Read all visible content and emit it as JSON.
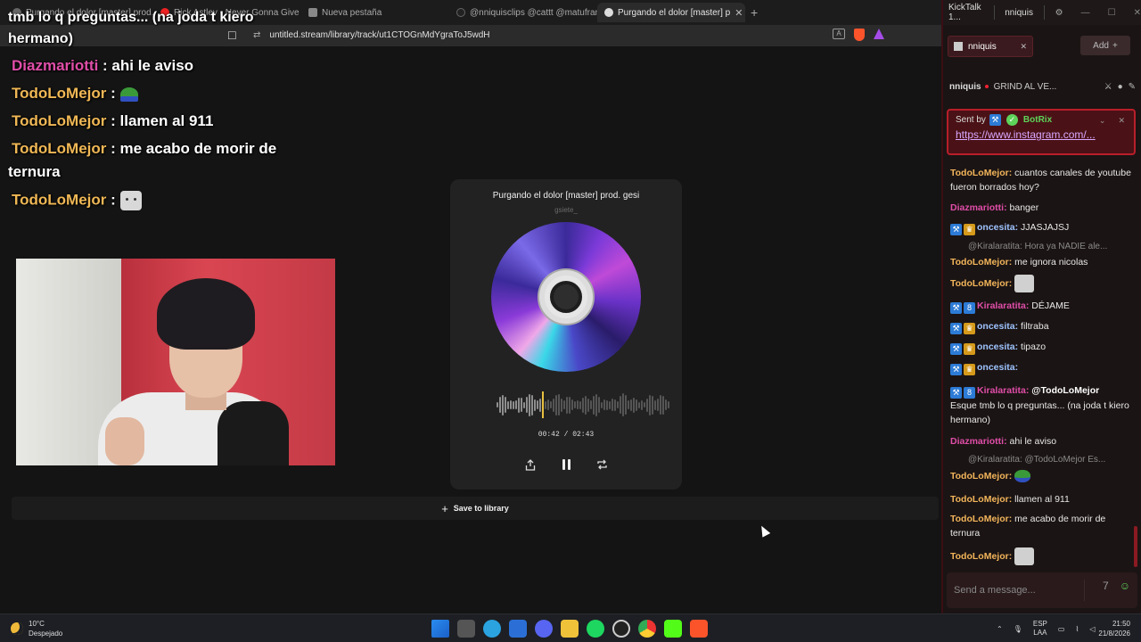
{
  "browser": {
    "tabs": [
      {
        "label": "Purgando el dolor [master] prod..."
      },
      {
        "label": "Rick Astley - Never Gonna Give You U"
      },
      {
        "label": "Nueva pestaña"
      },
      {
        "label": "@nniquisclips @cattt  @matufran"
      },
      {
        "label": "Purgando el dolor [master] p",
        "active": true
      }
    ],
    "url": "untitled.stream/library/track/ut1CTOGnMdYgraToJ5wdH"
  },
  "overlay": {
    "top_line_1": "tmb lo q preguntas... (na joda t kiero",
    "top_line_2": "hermano)",
    "msgs": [
      {
        "user": "Diazmariotti",
        "sep": " : ",
        "text": "ahi le aviso"
      },
      {
        "user": "TodoLoMejor",
        "sep": " : ",
        "text": ""
      },
      {
        "user": "TodoLoMejor",
        "sep": " : ",
        "text": "llamen al 911"
      },
      {
        "user": "TodoLoMejor",
        "sep": " : ",
        "text": "me acabo de morir de"
      },
      {
        "user": "TodoLoMejor",
        "sep": " : ",
        "text": ""
      }
    ],
    "wrap_text": "ternura"
  },
  "player": {
    "title": "Purgando el dolor [master] prod. gesi",
    "artist": "gsiete_",
    "time": "00:42 / 02:43",
    "progress": 0.26,
    "save_label": "Save to library"
  },
  "kicktalk": {
    "app_title": "KickTalk 1...",
    "user": "nniquis",
    "tab_label": "nniquis",
    "add_label": "Add",
    "channel": "nniquis",
    "stream_title": "GRIND AL VE...",
    "pinned": {
      "sent_by": "Sent by",
      "bot": "BotRix",
      "link": "https://www.instagram.com/..."
    },
    "chat": [
      {
        "user": "TodoLoMejor:",
        "text": "cuantos canales de youtube fueron borrados hoy?"
      },
      {
        "user": "Diazmariotti:",
        "text": "banger"
      },
      {
        "user": "oncesita:",
        "text": "JJASJAJSJ"
      },
      {
        "reply": "@Kiralaratita: Hora ya NADIE ale..."
      },
      {
        "user": "TodoLoMejor:",
        "text": "me ignora nicolas"
      },
      {
        "user": "TodoLoMejor:",
        "text": ""
      },
      {
        "user": "Kiralaratita:",
        "text": "DÉJAME"
      },
      {
        "user": "oncesita:",
        "text": "filtraba"
      },
      {
        "user": "oncesita:",
        "text": "tipazo"
      },
      {
        "user": "oncesita:",
        "text": ""
      },
      {
        "user": "Kiralaratita:",
        "text": "@TodoLoMejor"
      },
      {
        "text": "Esque tmb lo q preguntas... (na joda t kiero hermano)"
      },
      {
        "user": "Diazmariotti:",
        "text": "ahi le aviso"
      },
      {
        "reply": "@Kiralaratita: @TodoLoMejor Es..."
      },
      {
        "user": "TodoLoMejor:",
        "text": ""
      },
      {
        "user": "TodoLoMejor:",
        "text": "llamen al 911"
      },
      {
        "user": "TodoLoMejor:",
        "text": "me acabo de morir de ternura"
      },
      {
        "user": "TodoLoMejor:",
        "text": ""
      }
    ],
    "input_placeholder": "Send a message..."
  },
  "taskbar": {
    "temp": "10°C",
    "weather": "Despejado",
    "lang_1": "ESP",
    "lang_2": "LAA",
    "time": "21:50",
    "date": "21/8/2026"
  }
}
